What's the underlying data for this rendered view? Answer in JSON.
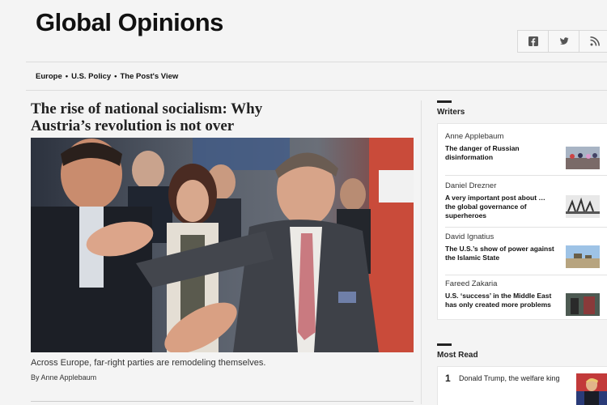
{
  "header": {
    "section_title": "Global Opinions"
  },
  "social": {
    "icons": [
      "facebook-icon",
      "twitter-icon",
      "rss-icon"
    ]
  },
  "subnav": {
    "items": [
      "Europe",
      "U.S. Policy",
      "The Post's View"
    ],
    "separator": "•"
  },
  "lead_story": {
    "headline_line1": "The rise of national socialism: Why",
    "headline_line2": "Austria’s revolution is not over",
    "caption": "Across Europe, far-right parties are remodeling themselves.",
    "byline_prefix": "By",
    "byline_author": "Anne Applebaum"
  },
  "writers": {
    "title": "Writers",
    "items": [
      {
        "name": "Anne Applebaum",
        "title": "The danger of Russian disinformation"
      },
      {
        "name": "Daniel Drezner",
        "title": "A very important post about … the global governance of superheroes"
      },
      {
        "name": "David Ignatius",
        "title": "The U.S.’s show of power against the Islamic State"
      },
      {
        "name": "Fareed Zakaria",
        "title": "U.S. ‘success’ in the Middle East has only created more problems"
      }
    ]
  },
  "most_read": {
    "title": "Most Read",
    "items": [
      {
        "rank": "1",
        "title": "Donald Trump, the welfare king"
      }
    ]
  },
  "colors": {
    "page_background": "#f4f4f4",
    "text": "#111111",
    "divider": "#dcdcdc"
  }
}
